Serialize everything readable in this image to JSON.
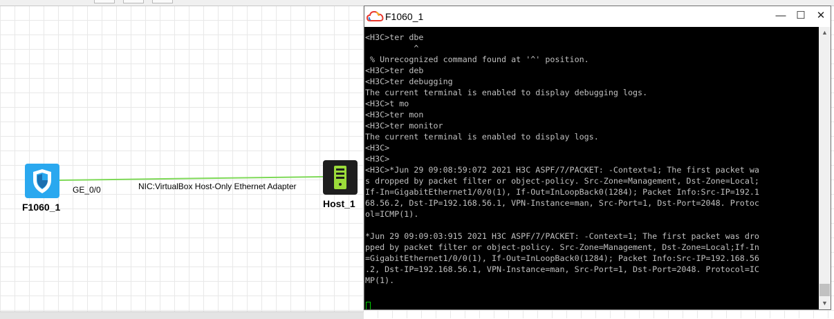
{
  "topology": {
    "firewall": {
      "name": "F1060_1",
      "port": "GE_0/0",
      "icon": "firewall-shield-icon",
      "color": "#2aa8ef"
    },
    "host": {
      "name": "Host_1",
      "icon": "host-server-icon",
      "color": "#1e1e1e"
    },
    "link": {
      "label": "NIC:VirtualBox Host-Only Ethernet Adapter",
      "color": "#7ed957"
    }
  },
  "terminal": {
    "title": "F1060_1",
    "app_icon": "cloud-icon",
    "buttons": {
      "minimize": "—",
      "maximize": "☐",
      "close": "✕"
    },
    "scroll_up": "▲",
    "scroll_down": "▼",
    "lines": [
      "<H3C>ter dbe",
      "          ^",
      " % Unrecognized command found at '^' position.",
      "<H3C>ter deb",
      "<H3C>ter debugging",
      "The current terminal is enabled to display debugging logs.",
      "<H3C>t mo",
      "<H3C>ter mon",
      "<H3C>ter monitor",
      "The current terminal is enabled to display logs.",
      "<H3C>",
      "<H3C>",
      "<H3C>*Jun 29 09:08:59:072 2021 H3C ASPF/7/PACKET: -Context=1; The first packet wa",
      "s dropped by packet filter or object-policy. Src-Zone=Management, Dst-Zone=Local;",
      "If-In=GigabitEthernet1/0/0(1), If-Out=InLoopBack0(1284); Packet Info:Src-IP=192.1",
      "68.56.2, Dst-IP=192.168.56.1, VPN-Instance=man, Src-Port=1, Dst-Port=2048. Protoc",
      "ol=ICMP(1).",
      "",
      "*Jun 29 09:09:03:915 2021 H3C ASPF/7/PACKET: -Context=1; The first packet was dro",
      "pped by packet filter or object-policy. Src-Zone=Management, Dst-Zone=Local;If-In",
      "=GigabitEthernet1/0/0(1), If-Out=InLoopBack0(1284); Packet Info:Src-IP=192.168.56",
      ".2, Dst-IP=192.168.56.1, VPN-Instance=man, Src-Port=1, Dst-Port=2048. Protocol=IC",
      "MP(1)."
    ],
    "cursor_color": "#00d000"
  }
}
